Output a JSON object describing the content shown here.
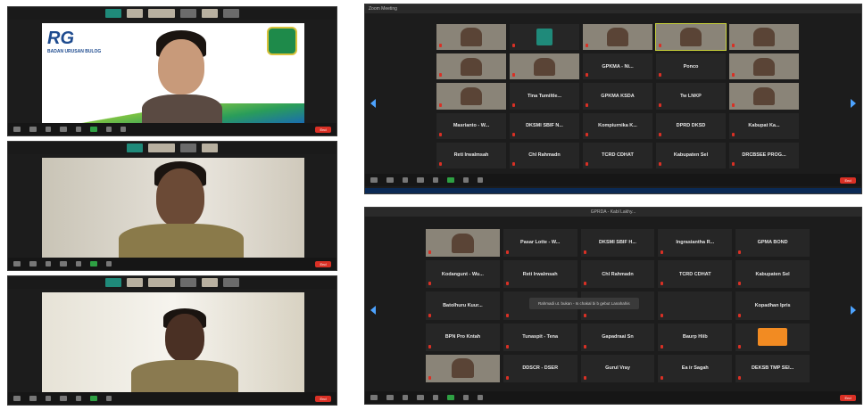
{
  "screenshots": [
    {
      "id": "a",
      "title": "Zoom Meeting"
    },
    {
      "id": "b",
      "title": ""
    },
    {
      "id": "c",
      "title": ""
    }
  ],
  "banner": {
    "logo_text": "BADAN URUSAN BULOG",
    "badge_text": "RG"
  },
  "toolbar": {
    "end_label": "End",
    "end_color": "#d93025"
  },
  "gallery_top": {
    "title": "Zoom Meeting",
    "tiles": [
      {
        "name": "",
        "sub": "",
        "kind": "video"
      },
      {
        "name": "",
        "sub": "",
        "kind": "green"
      },
      {
        "name": "",
        "sub": "",
        "kind": "video"
      },
      {
        "name": "",
        "sub": "",
        "kind": "video-hl"
      },
      {
        "name": "",
        "sub": "",
        "kind": "video"
      },
      {
        "name": "",
        "sub": "",
        "kind": "video"
      },
      {
        "name": "",
        "sub": "",
        "kind": "video"
      },
      {
        "name": "GPKMA - Ni...",
        "sub": "",
        "kind": "name"
      },
      {
        "name": "Ponco",
        "sub": "",
        "kind": "name"
      },
      {
        "name": "",
        "sub": "",
        "kind": "video"
      },
      {
        "name": "",
        "sub": "",
        "kind": "video"
      },
      {
        "name": "Tina Tumiltle...",
        "sub": "",
        "kind": "name"
      },
      {
        "name": "GPKMA KSDA",
        "sub": "",
        "kind": "name"
      },
      {
        "name": "Tw LNKP",
        "sub": "",
        "kind": "name"
      },
      {
        "name": "",
        "sub": "",
        "kind": "video"
      },
      {
        "name": "Masrianto - W...",
        "sub": "",
        "kind": "name"
      },
      {
        "name": "DKSMI SBIF N...",
        "sub": "",
        "kind": "name"
      },
      {
        "name": "Kompiurnika K...",
        "sub": "",
        "kind": "name"
      },
      {
        "name": "DPRD DKSD",
        "sub": "",
        "kind": "name"
      },
      {
        "name": "Kabupat Ka...",
        "sub": "",
        "kind": "name"
      },
      {
        "name": "Reti Irwalmsah",
        "sub": "",
        "kind": "name"
      },
      {
        "name": "Chl Rahmadn",
        "sub": "",
        "kind": "name"
      },
      {
        "name": "TCRD CDHAT",
        "sub": "",
        "kind": "name"
      },
      {
        "name": "Kabupaten Sel",
        "sub": "",
        "kind": "name"
      },
      {
        "name": "DRCBSEE PROG...",
        "sub": "",
        "kind": "name"
      }
    ]
  },
  "gallery_bottom": {
    "title": "GPRDA - Kabl Lakhy...",
    "toast": "Rahmadi ut. bukan - Is chakal bi b gebut Lanahahis",
    "tiles": [
      {
        "name": "",
        "sub": "",
        "kind": "video"
      },
      {
        "name": "Pasar Lotte - W...",
        "sub": "",
        "kind": "name"
      },
      {
        "name": "DKSMI SBIF H...",
        "sub": "",
        "kind": "name"
      },
      {
        "name": "Ingrasiantha R...",
        "sub": "",
        "kind": "name"
      },
      {
        "name": "GPMA BOND",
        "sub": "",
        "kind": "name"
      },
      {
        "name": "Kodangunt - Wu...",
        "sub": "",
        "kind": "name"
      },
      {
        "name": "Reti Irwalmsah",
        "sub": "",
        "kind": "name"
      },
      {
        "name": "Chl Rahmadn",
        "sub": "",
        "kind": "name"
      },
      {
        "name": "TCRD CDHAT",
        "sub": "",
        "kind": "name"
      },
      {
        "name": "Kabupaten Sel",
        "sub": "",
        "kind": "name"
      },
      {
        "name": "Batolhuru Kuur...",
        "sub": "",
        "kind": "name"
      },
      {
        "name": "",
        "sub": "",
        "kind": "empty"
      },
      {
        "name": "",
        "sub": "",
        "kind": "empty"
      },
      {
        "name": "",
        "sub": "",
        "kind": "empty"
      },
      {
        "name": "Kopadhan Ipris",
        "sub": "",
        "kind": "name"
      },
      {
        "name": "BPN Pro Kntah",
        "sub": "",
        "kind": "name"
      },
      {
        "name": "Tunaspit - Tena",
        "sub": "",
        "kind": "name"
      },
      {
        "name": "Gapadraai Sn",
        "sub": "",
        "kind": "name"
      },
      {
        "name": "Baurp Hiib",
        "sub": "",
        "kind": "name"
      },
      {
        "name": "",
        "sub": "",
        "kind": "orange"
      },
      {
        "name": "",
        "sub": "",
        "kind": "video"
      },
      {
        "name": "DDSCR - DSER",
        "sub": "",
        "kind": "name"
      },
      {
        "name": "Gurul Vray",
        "sub": "",
        "kind": "name"
      },
      {
        "name": "Ea ir Sagah",
        "sub": "",
        "kind": "name"
      },
      {
        "name": "DEKSB TMP SEI...",
        "sub": "",
        "kind": "name"
      }
    ]
  },
  "colors": {
    "zoom_bg": "#1c1c1c",
    "tile_bg": "#262626",
    "accent_blue": "#4da3ff",
    "orange": "#f28b22"
  }
}
